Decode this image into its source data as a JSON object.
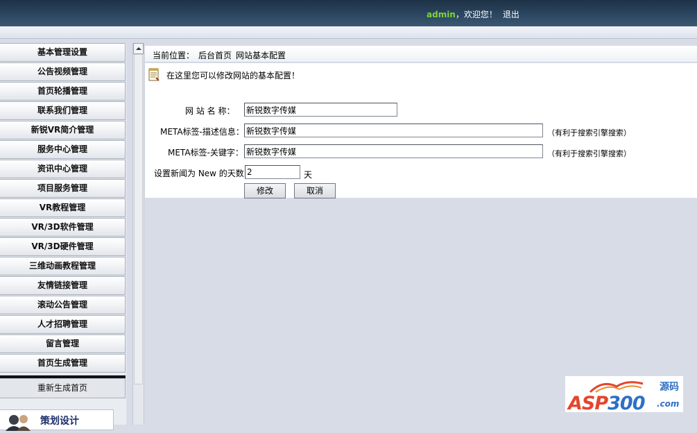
{
  "header": {
    "username": "admin",
    "welcome": "，欢迎您！",
    "logout": "退出"
  },
  "sidebar": {
    "items": [
      {
        "label": "基本管理设置"
      },
      {
        "label": "公告视频管理"
      },
      {
        "label": "首页轮播管理"
      },
      {
        "label": "联系我们管理"
      },
      {
        "label": "新锐VR简介管理"
      },
      {
        "label": "服务中心管理"
      },
      {
        "label": "资讯中心管理"
      },
      {
        "label": "项目服务管理"
      },
      {
        "label": "VR教程管理"
      },
      {
        "label": "VR/3D软件管理"
      },
      {
        "label": "VR/3D硬件管理"
      },
      {
        "label": "三维动画教程管理"
      },
      {
        "label": "友情链接管理"
      },
      {
        "label": "滚动公告管理"
      },
      {
        "label": "人才招聘管理"
      },
      {
        "label": "留言管理"
      },
      {
        "label": "首页生成管理"
      }
    ],
    "regenerate": "重新生成首页",
    "planning": "策划设计"
  },
  "breadcrumb": {
    "prefix": "当前位置：",
    "home": "后台首页",
    "current": "网站基本配置"
  },
  "notice": "在这里您可以修改网站的基本配置！",
  "form": {
    "site_name_label": "网 站 名 称：",
    "site_name_value": "新锐数字传媒",
    "meta_desc_label": "META标签-描述信息：",
    "meta_desc_value": "新锐数字传媒",
    "meta_desc_hint": "（有利于搜索引擎搜索）",
    "meta_kw_label": "META标签-关键字：",
    "meta_kw_value": "新锐数字传媒",
    "meta_kw_hint": "（有利于搜索引擎搜索）",
    "news_days_label": "设置新闻为 New 的天数",
    "news_days_value": "2",
    "news_days_unit": "天",
    "submit": "修改",
    "cancel": "取消"
  },
  "watermark": {
    "brand_left": "ASP",
    "brand_num": "300",
    "brand_cn": "源码",
    "domain": ".com"
  },
  "colors": {
    "header_bg": "#2b4660",
    "username": "#7fd23a",
    "page_bg": "#d8dce6"
  }
}
